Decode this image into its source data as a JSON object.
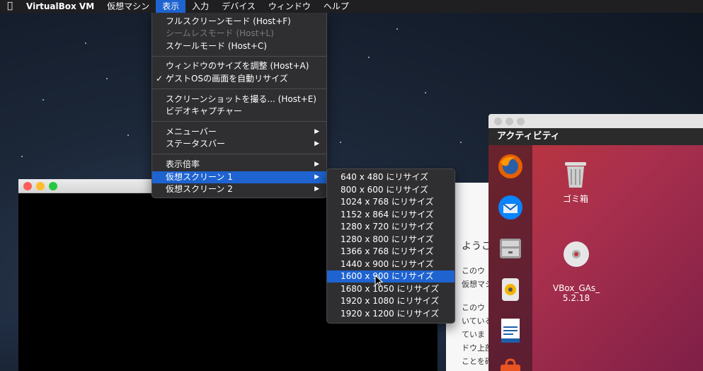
{
  "menubar": {
    "app_name": "VirtualBox VM",
    "items": [
      "仮想マシン",
      "表示",
      "入力",
      "デバイス",
      "ウィンドウ",
      "ヘルプ"
    ],
    "active_item": "表示"
  },
  "view_menu": {
    "items": [
      {
        "label": "フルスクリーンモード (Host+F)",
        "disabled": false
      },
      {
        "label": "シームレスモード (Host+L)",
        "disabled": true
      },
      {
        "label": "スケールモード (Host+C)",
        "disabled": false
      },
      {
        "label": "ウィンドウのサイズを調整 (Host+A)",
        "disabled": false
      },
      {
        "label": "ゲストOSの画面を自動リサイズ",
        "checked": true
      },
      {
        "label": "スクリーンショットを撮る... (Host+E)"
      },
      {
        "label": "ビデオキャプチャー"
      },
      {
        "label": "メニューバー",
        "submenu": true
      },
      {
        "label": "ステータスバー",
        "submenu": true
      },
      {
        "label": "表示倍率",
        "submenu": true
      },
      {
        "label": "仮想スクリーン 1",
        "submenu": true,
        "highlighted": true
      },
      {
        "label": "仮想スクリーン 2",
        "submenu": true
      }
    ],
    "checkmark": "✓",
    "arrow": "▶"
  },
  "screen_submenu": {
    "items": [
      "640 x 480 にリサイズ",
      "800 x 600 にリサイズ",
      "1024 x 768 にリサイズ",
      "1152 x 864 にリサイズ",
      "1280 x 720 にリサイズ",
      "1280 x 800 にリサイズ",
      "1366 x 768 にリサイズ",
      "1440 x 900 にリサイズ",
      "1600 x 900 にリサイズ",
      "1680 x 1050 にリサイズ",
      "1920 x 1080 にリサイズ",
      "1920 x 1200 にリサイズ"
    ],
    "highlighted": "1600 x 900 にリサイズ"
  },
  "welcome_panel": {
    "heading": "ようこ",
    "lines": [
      "このウ",
      "仮想マシ",
      "このウ",
      "いている",
      "ていま",
      "ドウ上部",
      "ことを確"
    ]
  },
  "ubuntu": {
    "activities": "アクティビティ",
    "desktop_icons": [
      {
        "label": "ゴミ箱",
        "icon": "trash-icon"
      },
      {
        "label": "VBox_GAs_\n5.2.18",
        "icon": "disc-icon"
      }
    ],
    "dock_icons": [
      "firefox-icon",
      "thunderbird-icon",
      "files-icon",
      "rhythmbox-icon",
      "writer-icon",
      "software-icon"
    ]
  },
  "colors": {
    "menu_highlight": "#1e63d0",
    "menu_bg": "#2f2f31",
    "ubuntu_red": "#c0383b"
  }
}
